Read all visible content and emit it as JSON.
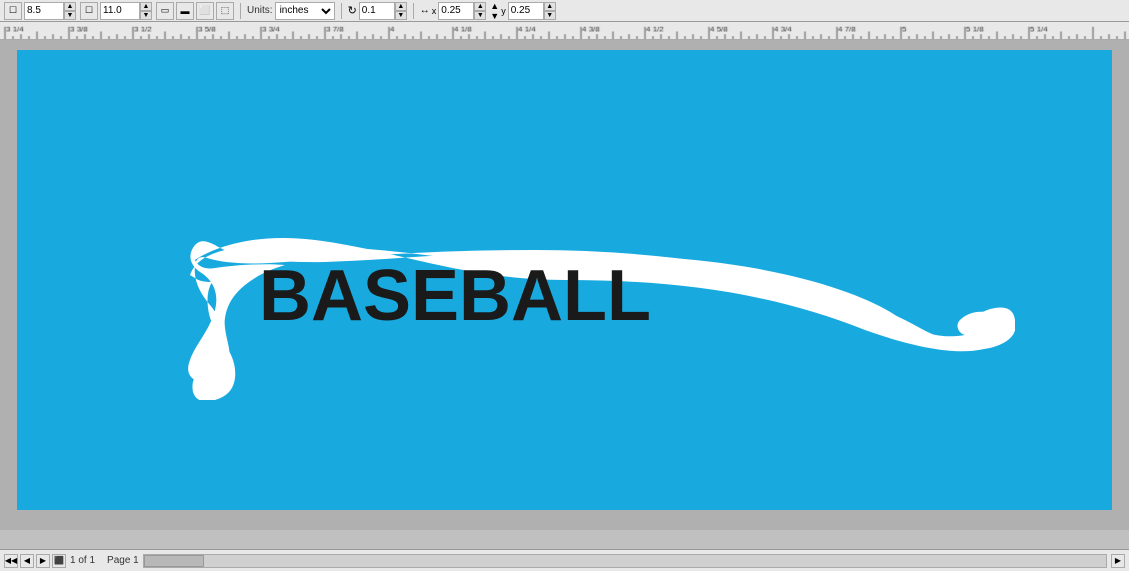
{
  "toolbar": {
    "width_label": "8.5",
    "height_label": "11.0",
    "units_label": "Units:",
    "units_value": "inches",
    "rotation_label": "0.1",
    "cx_label": "0.25",
    "cy_label": "0.25",
    "page_icons": [
      "portrait",
      "landscape",
      "rotated",
      "facing"
    ],
    "arrow_icon": "▲",
    "arrow_down": "▼"
  },
  "ruler": {
    "tick_color": "#666",
    "bg": "#e8e8e8",
    "marks": [
      "3 1/4",
      "3 3/8",
      "3 1/2",
      "3 5/8",
      "3 3/4",
      "3 7/8",
      "4",
      "4 1/8",
      "4 1/4",
      "4 3/8",
      "4 1/2",
      "4 5/8",
      "4 3/4",
      "4 7/8",
      "5",
      "5 1/8",
      "5 1/4"
    ]
  },
  "canvas": {
    "bg_color": "#18aadf",
    "swoosh_text": "BASEBALL",
    "swoosh_fill": "#ffffff",
    "text_fill": "#1a1a1a"
  },
  "statusbar": {
    "page_info": "1 of 1",
    "page_label": "Page 1"
  }
}
